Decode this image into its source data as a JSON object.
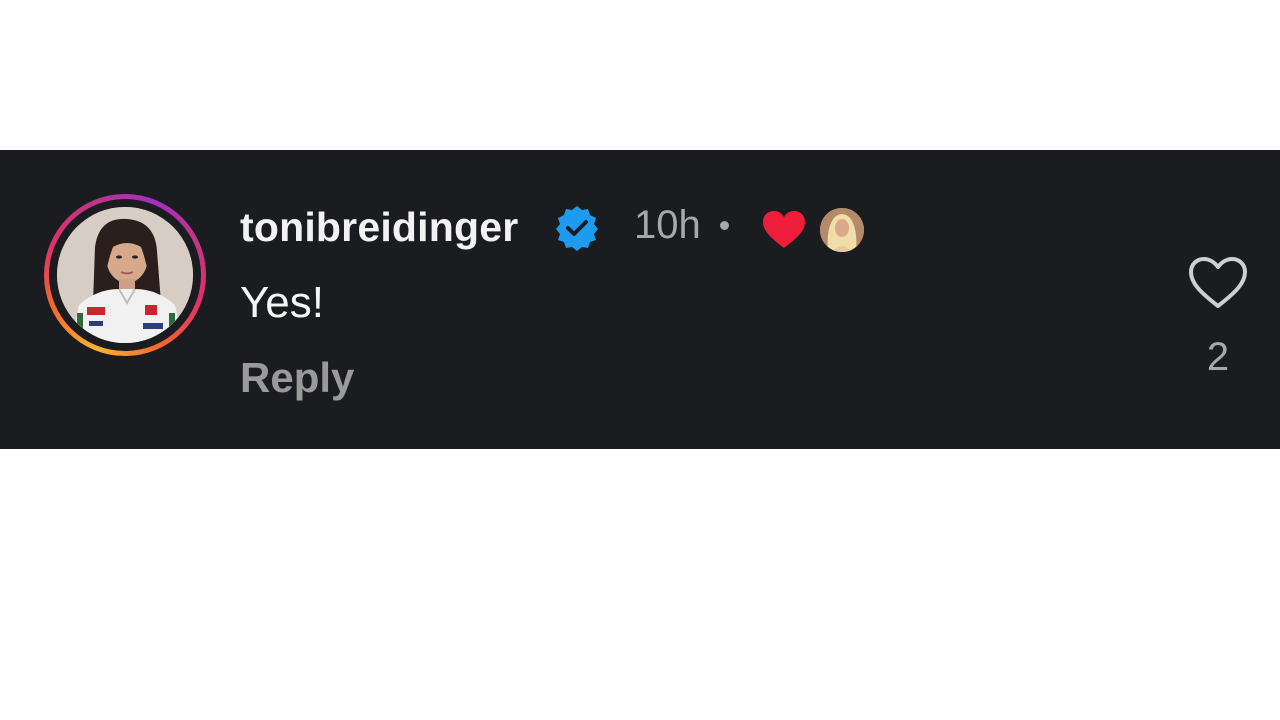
{
  "comment": {
    "username": "tonibreidinger",
    "verified": true,
    "timestamp": "10h",
    "text": "Yes!",
    "reply_label": "Reply",
    "like_count": "2",
    "liked_by_creator": true
  },
  "icons": {
    "verified": "verified-badge-icon",
    "creator_heart": "red-heart-icon",
    "like": "heart-outline-icon"
  },
  "colors": {
    "background": "#1b1c1f",
    "username": "#f2f2f2",
    "muted": "#a8a8a8",
    "verified": "#1d9bf0",
    "heart": "#ee1d3a"
  }
}
